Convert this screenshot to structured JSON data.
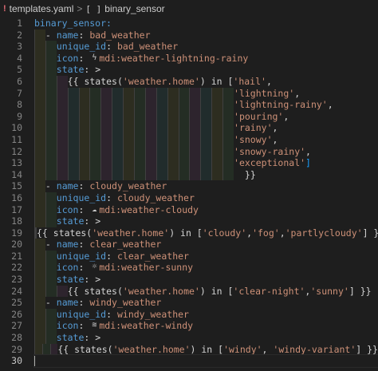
{
  "breadcrumb": {
    "file_icon": "!",
    "file": "templates.yaml",
    "separator": ">",
    "bracket_icon": "[ ]",
    "symbol": "binary_sensor"
  },
  "colors": {
    "keyword": "#569cd6",
    "string": "#ce9178",
    "line_number": "#858585",
    "background": "#1e1e1e"
  },
  "line_numbers": [
    "1",
    "2",
    "3",
    "4",
    "5",
    "6",
    "7",
    "8",
    "9",
    "10",
    "11",
    "12",
    "13",
    "14",
    "15",
    "16",
    "17",
    "18",
    "19",
    "20",
    "21",
    "22",
    "23",
    "24",
    "25",
    "26",
    "27",
    "28",
    "29",
    "30"
  ],
  "icons": {
    "lightning_rainy": "weather-lightning-rainy-icon",
    "cloudy": "weather-cloudy-icon",
    "sunny": "weather-sunny-icon",
    "windy": "weather-windy-icon"
  },
  "code": {
    "l1": "binary_sensor:",
    "name_key": "name",
    "unique_key": "unique_id",
    "icon_key": "icon",
    "state_key": "state",
    "gt": ">",
    "dash": "-",
    "colon": ":",
    "s1_name": "bad_weather",
    "s1_uid": "bad_weather",
    "s1_icon": "mdi:weather-lightning-rainy",
    "s1_open": "{{ states(",
    "s1_entity": "'weather.home'",
    "s1_in": ") in [",
    "s1_v1": "'hail'",
    "s1_v2": "'lightning'",
    "s1_v3": "'lightning-rainy'",
    "s1_v4": "'pouring'",
    "s1_v5": "'rainy'",
    "s1_v6": "'snowy'",
    "s1_v7": "'snowy-rainy'",
    "s1_v8": "'exceptional'",
    "s1_close": "}}",
    "s2_name": "cloudy_weather",
    "s2_uid": "cloudy_weather",
    "s2_icon": "mdi:weather-cloudy",
    "s2_v": "'cloudy'",
    "s2_v2": "'fog'",
    "s2_v3": "'partlycloudy'",
    "s3_name": "clear_weather",
    "s3_uid": "clear_weather",
    "s3_icon": "mdi:weather-sunny",
    "s3_v": "'clear-night'",
    "s3_v2": "'sunny'",
    "s4_name": "windy_weather",
    "s4_uid": "windy_weather",
    "s4_icon": "mdi:weather-windy",
    "s4_v": "'windy'",
    "s4_v2": "'windy-variant'"
  }
}
